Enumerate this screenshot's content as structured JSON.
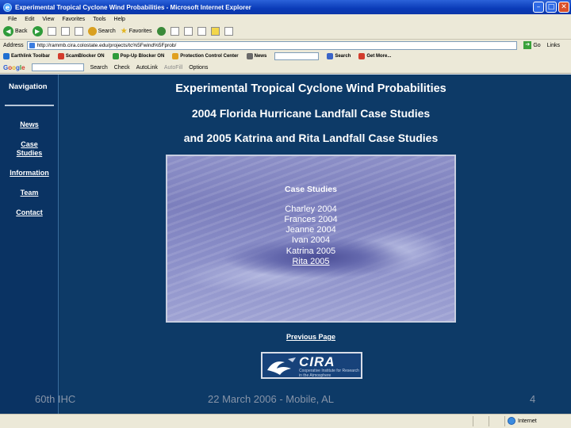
{
  "window": {
    "title": "Experimental Tropical Cyclone Wind Probabilities - Microsoft Internet Explorer"
  },
  "menu": [
    "File",
    "Edit",
    "View",
    "Favorites",
    "Tools",
    "Help"
  ],
  "toolbar": {
    "back": "Back",
    "search": "Search",
    "favorites": "Favorites"
  },
  "address": {
    "label": "Address",
    "url": "http://rammb.cira.colostate.edu/projects/tc%5Fwind%5Fprob/",
    "go": "Go",
    "links": "Links"
  },
  "linksbar": [
    {
      "label": "Earthlink Toolbar",
      "color": "#1f6fd1"
    },
    {
      "label": "ScamBlocker ON",
      "color": "#d23c2c"
    },
    {
      "label": "Pop-Up Blocker ON",
      "color": "#2e9b3a"
    },
    {
      "label": "Protection Control Center",
      "color": "#e0a020"
    },
    {
      "label": "News",
      "color": "#6a6a6a"
    },
    {
      "label": "Search",
      "color": "#3a64c8"
    },
    {
      "label": "Get More...",
      "color": "#d23c2c"
    }
  ],
  "googlebar": {
    "logo": "Google",
    "search": "Search",
    "check": "Check",
    "autolink": "AutoLink",
    "autofill": "AutoFill",
    "options": "Options"
  },
  "nav": {
    "heading": "Navigation",
    "items": [
      {
        "label": "News"
      },
      {
        "label": "Case Studies"
      },
      {
        "label": "Information"
      },
      {
        "label": "Team"
      },
      {
        "label": "Contact"
      }
    ]
  },
  "main": {
    "headings": [
      "Experimental Tropical Cyclone Wind Probabilities",
      "2004 Florida Hurricane Landfall Case Studies",
      "and 2005 Katrina and Rita Landfall Case Studies"
    ],
    "case_studies_title": "Case Studies",
    "storms": [
      {
        "label": "Charley 2004",
        "link": false
      },
      {
        "label": "Frances 2004",
        "link": false
      },
      {
        "label": "Jeanne 2004",
        "link": false
      },
      {
        "label": "Ivan 2004",
        "link": false
      },
      {
        "label": "Katrina 2005",
        "link": false
      },
      {
        "label": "Rita 2005",
        "link": true
      }
    ],
    "previous_page": "Previous Page",
    "logo": {
      "word": "CIRA",
      "subtitle": "Cooperative Institute for Research in the Atmosphere"
    }
  },
  "status": {
    "zone": "Internet"
  },
  "slide_footer": {
    "left": "60th IHC",
    "center": "22 March 2006  -  Mobile, AL",
    "page": "4"
  }
}
